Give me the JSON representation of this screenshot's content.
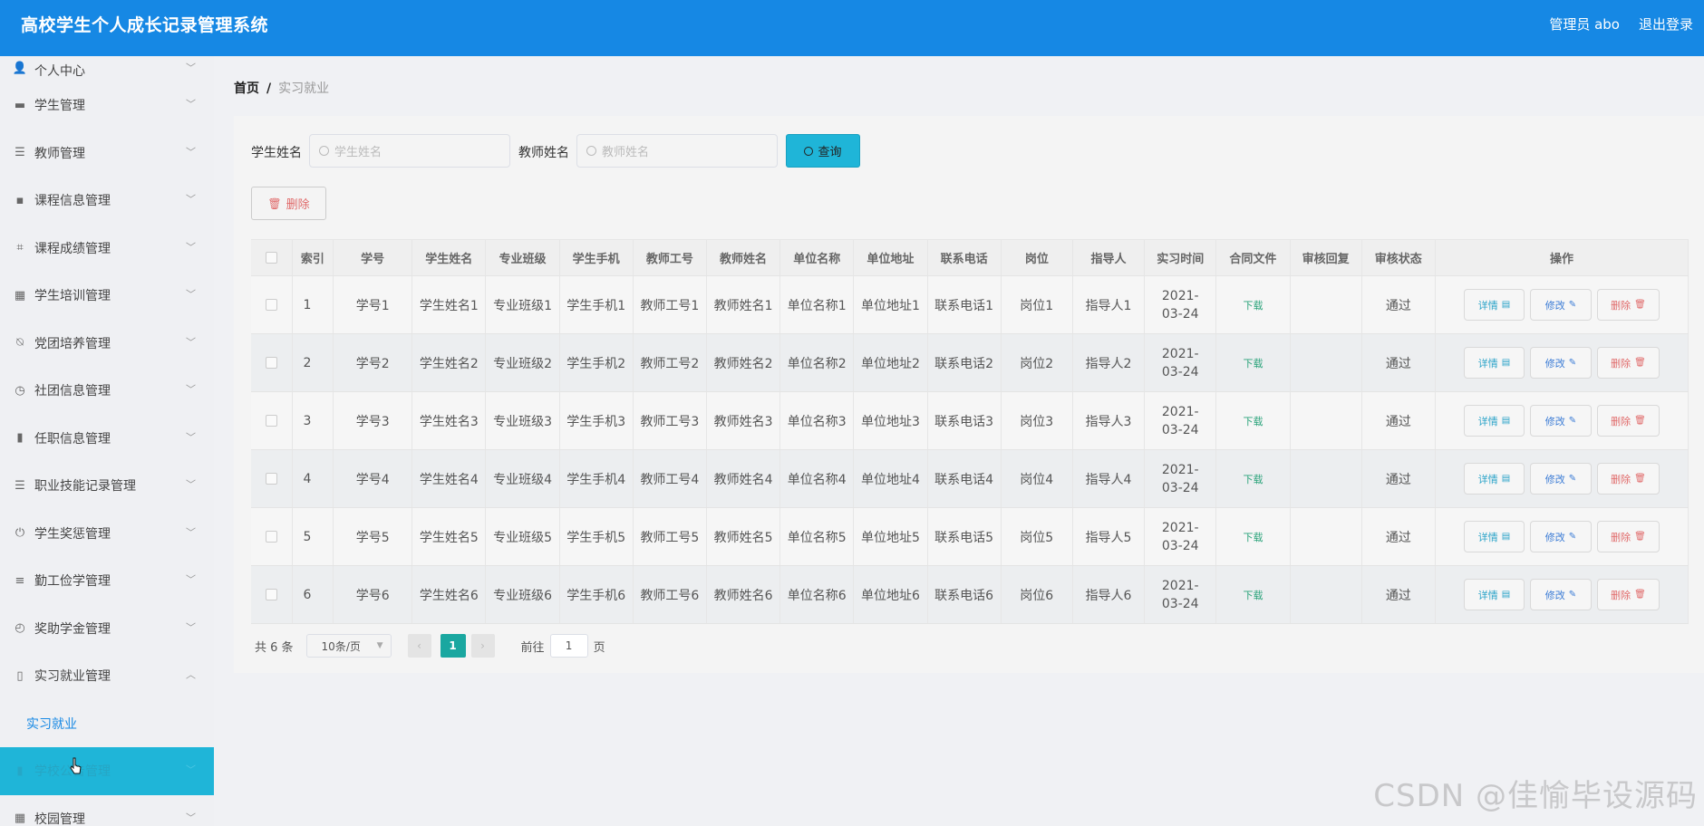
{
  "header": {
    "title": "高校学生个人成长记录管理系统",
    "user": "管理员 abo",
    "logout": "退出登录"
  },
  "sidebar": {
    "items": [
      {
        "label": "个人中心",
        "icon": "user-icon"
      },
      {
        "label": "学生管理",
        "icon": "monitor-icon"
      },
      {
        "label": "教师管理",
        "icon": "list-icon"
      },
      {
        "label": "课程信息管理",
        "icon": "chat-icon"
      },
      {
        "label": "课程成绩管理",
        "icon": "crop-icon"
      },
      {
        "label": "学生培训管理",
        "icon": "grid-icon"
      },
      {
        "label": "党团培养管理",
        "icon": "bell-off-icon"
      },
      {
        "label": "社团信息管理",
        "icon": "clock-icon"
      },
      {
        "label": "任职信息管理",
        "icon": "office-icon"
      },
      {
        "label": "职业技能记录管理",
        "icon": "list-icon"
      },
      {
        "label": "学生奖惩管理",
        "icon": "power-icon"
      },
      {
        "label": "勤工俭学管理",
        "icon": "sliders-icon"
      },
      {
        "label": "奖助学金管理",
        "icon": "gauge-icon"
      },
      {
        "label": "实习就业管理",
        "icon": "mic-icon"
      }
    ],
    "sub_item": "实习就业",
    "active_item": "学校公告管理",
    "last_item": "校园管理"
  },
  "breadcrumb": {
    "home": "首页",
    "sep": "/",
    "current": "实习就业"
  },
  "search": {
    "student_label": "学生姓名",
    "student_placeholder": "学生姓名",
    "teacher_label": "教师姓名",
    "teacher_placeholder": "教师姓名",
    "query_button": "查询",
    "delete_button": "删除"
  },
  "table": {
    "columns": [
      "索引",
      "学号",
      "学生姓名",
      "专业班级",
      "学生手机",
      "教师工号",
      "教师姓名",
      "单位名称",
      "单位地址",
      "联系电话",
      "岗位",
      "指导人",
      "实习时间",
      "合同文件",
      "审核回复",
      "审核状态",
      "操作"
    ],
    "rows": [
      [
        "1",
        "学号1",
        "学生姓名1",
        "专业班级1",
        "学生手机1",
        "教师工号1",
        "教师姓名1",
        "单位名称1",
        "单位地址1",
        "联系电话1",
        "岗位1",
        "指导人1",
        "2021-03-24",
        "下载",
        "",
        "通过"
      ],
      [
        "2",
        "学号2",
        "学生姓名2",
        "专业班级2",
        "学生手机2",
        "教师工号2",
        "教师姓名2",
        "单位名称2",
        "单位地址2",
        "联系电话2",
        "岗位2",
        "指导人2",
        "2021-03-24",
        "下载",
        "",
        "通过"
      ],
      [
        "3",
        "学号3",
        "学生姓名3",
        "专业班级3",
        "学生手机3",
        "教师工号3",
        "教师姓名3",
        "单位名称3",
        "单位地址3",
        "联系电话3",
        "岗位3",
        "指导人3",
        "2021-03-24",
        "下载",
        "",
        "通过"
      ],
      [
        "4",
        "学号4",
        "学生姓名4",
        "专业班级4",
        "学生手机4",
        "教师工号4",
        "教师姓名4",
        "单位名称4",
        "单位地址4",
        "联系电话4",
        "岗位4",
        "指导人4",
        "2021-03-24",
        "下载",
        "",
        "通过"
      ],
      [
        "5",
        "学号5",
        "学生姓名5",
        "专业班级5",
        "学生手机5",
        "教师工号5",
        "教师姓名5",
        "单位名称5",
        "单位地址5",
        "联系电话5",
        "岗位5",
        "指导人5",
        "2021-03-24",
        "下载",
        "",
        "通过"
      ],
      [
        "6",
        "学号6",
        "学生姓名6",
        "专业班级6",
        "学生手机6",
        "教师工号6",
        "教师姓名6",
        "单位名称6",
        "单位地址6",
        "联系电话6",
        "岗位6",
        "指导人6",
        "2021-03-24",
        "下载",
        "",
        "通过"
      ]
    ],
    "actions": {
      "detail": "详情",
      "edit": "修改",
      "delete": "删除"
    }
  },
  "pagination": {
    "total": "共 6 条",
    "page_size": "10条/页",
    "current_page": "1",
    "goto_prefix": "前往",
    "goto_value": "1",
    "goto_suffix": "页"
  },
  "watermark": "CSDN @佳愉毕设源码",
  "colors": {
    "header": "#1688e4",
    "accent": "#1fb5d8",
    "page_active": "#1aa7a0"
  }
}
